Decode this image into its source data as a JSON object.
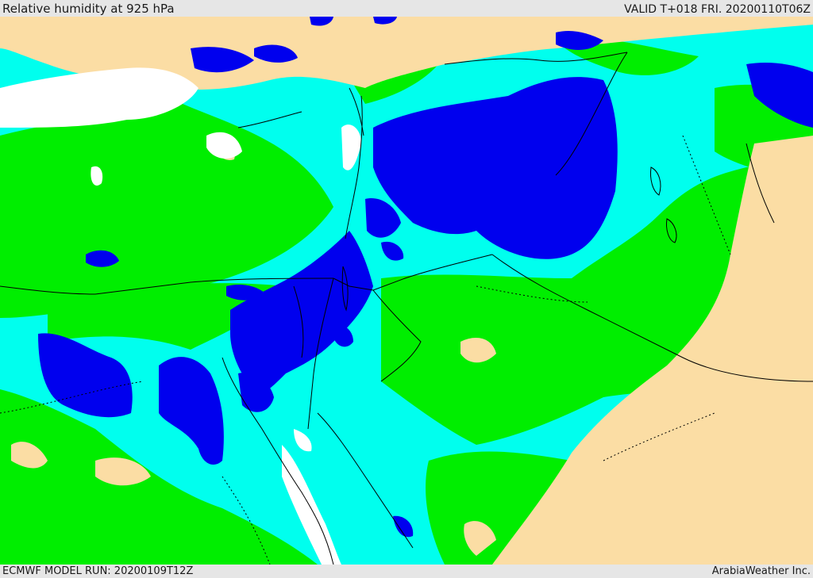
{
  "header": {
    "title": "Relative humidity at 925 hPa",
    "valid": "VALID T+018 FRI. 20200110T06Z"
  },
  "footer": {
    "model_run": "ECMWF MODEL RUN: 20200109T12Z",
    "brand": "ArabiaWeather Inc."
  },
  "colors": {
    "very_humid": "#0000ee",
    "humid": "#00ffee",
    "moderate": "#00ee00",
    "dry": "#fbdda4",
    "saturated_land": "#ffffff",
    "border": "#000000"
  }
}
